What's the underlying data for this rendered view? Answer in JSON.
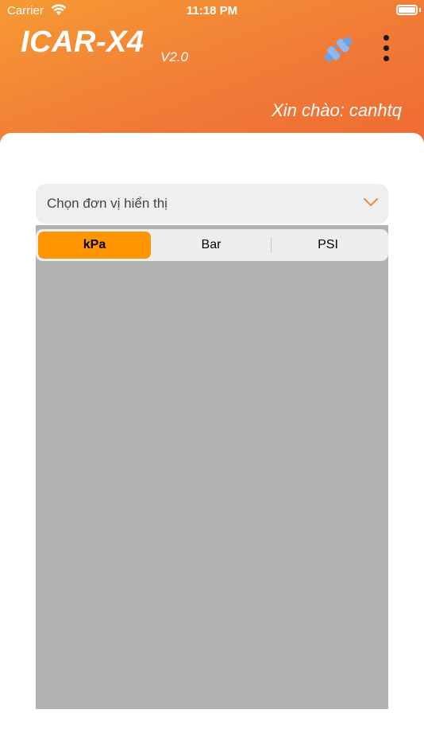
{
  "status_bar": {
    "carrier": "Carrier",
    "time": "11:18 PM"
  },
  "header": {
    "app_title": "ICAR-X4",
    "version": "V2.0",
    "greeting": "Xin chào: canhtq",
    "plug_icon": "plug-disconnected-icon",
    "menu_icon": "more-vertical-icon"
  },
  "unit_selector": {
    "label": "Chọn đơn vị hiển thị",
    "chevron_icon": "chevron-down-icon"
  },
  "segments": [
    {
      "label": "kPa",
      "selected": true
    },
    {
      "label": "Bar",
      "selected": false
    },
    {
      "label": "PSI",
      "selected": false
    }
  ],
  "colors": {
    "header_gradient_start": "#f69a33",
    "header_gradient_end": "#ef6a33",
    "segment_active": "#ff9500",
    "panel": "#b2b2b2",
    "chevron": "#f08a3a"
  }
}
